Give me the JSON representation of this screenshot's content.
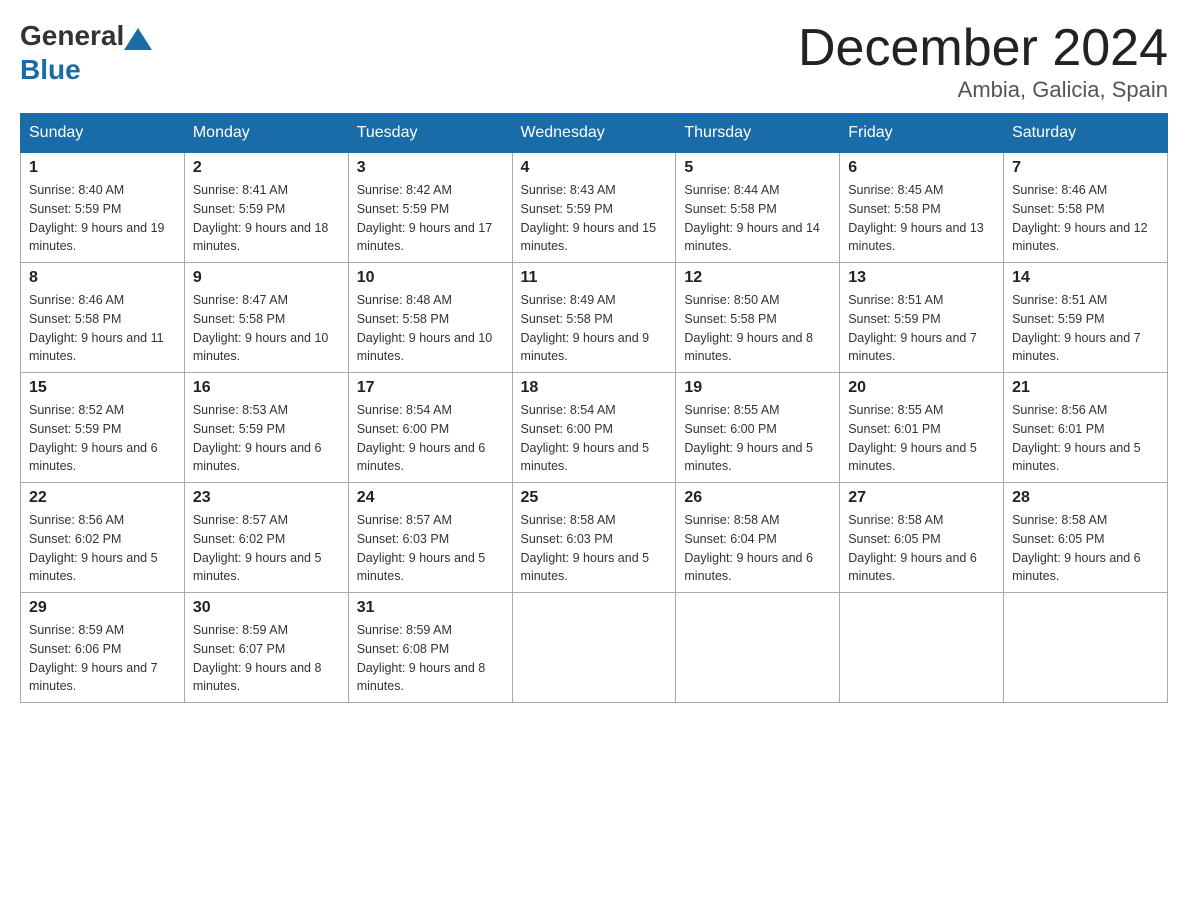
{
  "header": {
    "logo_general": "General",
    "logo_blue": "Blue",
    "month_title": "December 2024",
    "location": "Ambia, Galicia, Spain"
  },
  "weekdays": [
    "Sunday",
    "Monday",
    "Tuesday",
    "Wednesday",
    "Thursday",
    "Friday",
    "Saturday"
  ],
  "weeks": [
    [
      {
        "day": "1",
        "sunrise": "8:40 AM",
        "sunset": "5:59 PM",
        "daylight": "9 hours and 19 minutes."
      },
      {
        "day": "2",
        "sunrise": "8:41 AM",
        "sunset": "5:59 PM",
        "daylight": "9 hours and 18 minutes."
      },
      {
        "day": "3",
        "sunrise": "8:42 AM",
        "sunset": "5:59 PM",
        "daylight": "9 hours and 17 minutes."
      },
      {
        "day": "4",
        "sunrise": "8:43 AM",
        "sunset": "5:59 PM",
        "daylight": "9 hours and 15 minutes."
      },
      {
        "day": "5",
        "sunrise": "8:44 AM",
        "sunset": "5:58 PM",
        "daylight": "9 hours and 14 minutes."
      },
      {
        "day": "6",
        "sunrise": "8:45 AM",
        "sunset": "5:58 PM",
        "daylight": "9 hours and 13 minutes."
      },
      {
        "day": "7",
        "sunrise": "8:46 AM",
        "sunset": "5:58 PM",
        "daylight": "9 hours and 12 minutes."
      }
    ],
    [
      {
        "day": "8",
        "sunrise": "8:46 AM",
        "sunset": "5:58 PM",
        "daylight": "9 hours and 11 minutes."
      },
      {
        "day": "9",
        "sunrise": "8:47 AM",
        "sunset": "5:58 PM",
        "daylight": "9 hours and 10 minutes."
      },
      {
        "day": "10",
        "sunrise": "8:48 AM",
        "sunset": "5:58 PM",
        "daylight": "9 hours and 10 minutes."
      },
      {
        "day": "11",
        "sunrise": "8:49 AM",
        "sunset": "5:58 PM",
        "daylight": "9 hours and 9 minutes."
      },
      {
        "day": "12",
        "sunrise": "8:50 AM",
        "sunset": "5:58 PM",
        "daylight": "9 hours and 8 minutes."
      },
      {
        "day": "13",
        "sunrise": "8:51 AM",
        "sunset": "5:59 PM",
        "daylight": "9 hours and 7 minutes."
      },
      {
        "day": "14",
        "sunrise": "8:51 AM",
        "sunset": "5:59 PM",
        "daylight": "9 hours and 7 minutes."
      }
    ],
    [
      {
        "day": "15",
        "sunrise": "8:52 AM",
        "sunset": "5:59 PM",
        "daylight": "9 hours and 6 minutes."
      },
      {
        "day": "16",
        "sunrise": "8:53 AM",
        "sunset": "5:59 PM",
        "daylight": "9 hours and 6 minutes."
      },
      {
        "day": "17",
        "sunrise": "8:54 AM",
        "sunset": "6:00 PM",
        "daylight": "9 hours and 6 minutes."
      },
      {
        "day": "18",
        "sunrise": "8:54 AM",
        "sunset": "6:00 PM",
        "daylight": "9 hours and 5 minutes."
      },
      {
        "day": "19",
        "sunrise": "8:55 AM",
        "sunset": "6:00 PM",
        "daylight": "9 hours and 5 minutes."
      },
      {
        "day": "20",
        "sunrise": "8:55 AM",
        "sunset": "6:01 PM",
        "daylight": "9 hours and 5 minutes."
      },
      {
        "day": "21",
        "sunrise": "8:56 AM",
        "sunset": "6:01 PM",
        "daylight": "9 hours and 5 minutes."
      }
    ],
    [
      {
        "day": "22",
        "sunrise": "8:56 AM",
        "sunset": "6:02 PM",
        "daylight": "9 hours and 5 minutes."
      },
      {
        "day": "23",
        "sunrise": "8:57 AM",
        "sunset": "6:02 PM",
        "daylight": "9 hours and 5 minutes."
      },
      {
        "day": "24",
        "sunrise": "8:57 AM",
        "sunset": "6:03 PM",
        "daylight": "9 hours and 5 minutes."
      },
      {
        "day": "25",
        "sunrise": "8:58 AM",
        "sunset": "6:03 PM",
        "daylight": "9 hours and 5 minutes."
      },
      {
        "day": "26",
        "sunrise": "8:58 AM",
        "sunset": "6:04 PM",
        "daylight": "9 hours and 6 minutes."
      },
      {
        "day": "27",
        "sunrise": "8:58 AM",
        "sunset": "6:05 PM",
        "daylight": "9 hours and 6 minutes."
      },
      {
        "day": "28",
        "sunrise": "8:58 AM",
        "sunset": "6:05 PM",
        "daylight": "9 hours and 6 minutes."
      }
    ],
    [
      {
        "day": "29",
        "sunrise": "8:59 AM",
        "sunset": "6:06 PM",
        "daylight": "9 hours and 7 minutes."
      },
      {
        "day": "30",
        "sunrise": "8:59 AM",
        "sunset": "6:07 PM",
        "daylight": "9 hours and 8 minutes."
      },
      {
        "day": "31",
        "sunrise": "8:59 AM",
        "sunset": "6:08 PM",
        "daylight": "9 hours and 8 minutes."
      },
      null,
      null,
      null,
      null
    ]
  ]
}
